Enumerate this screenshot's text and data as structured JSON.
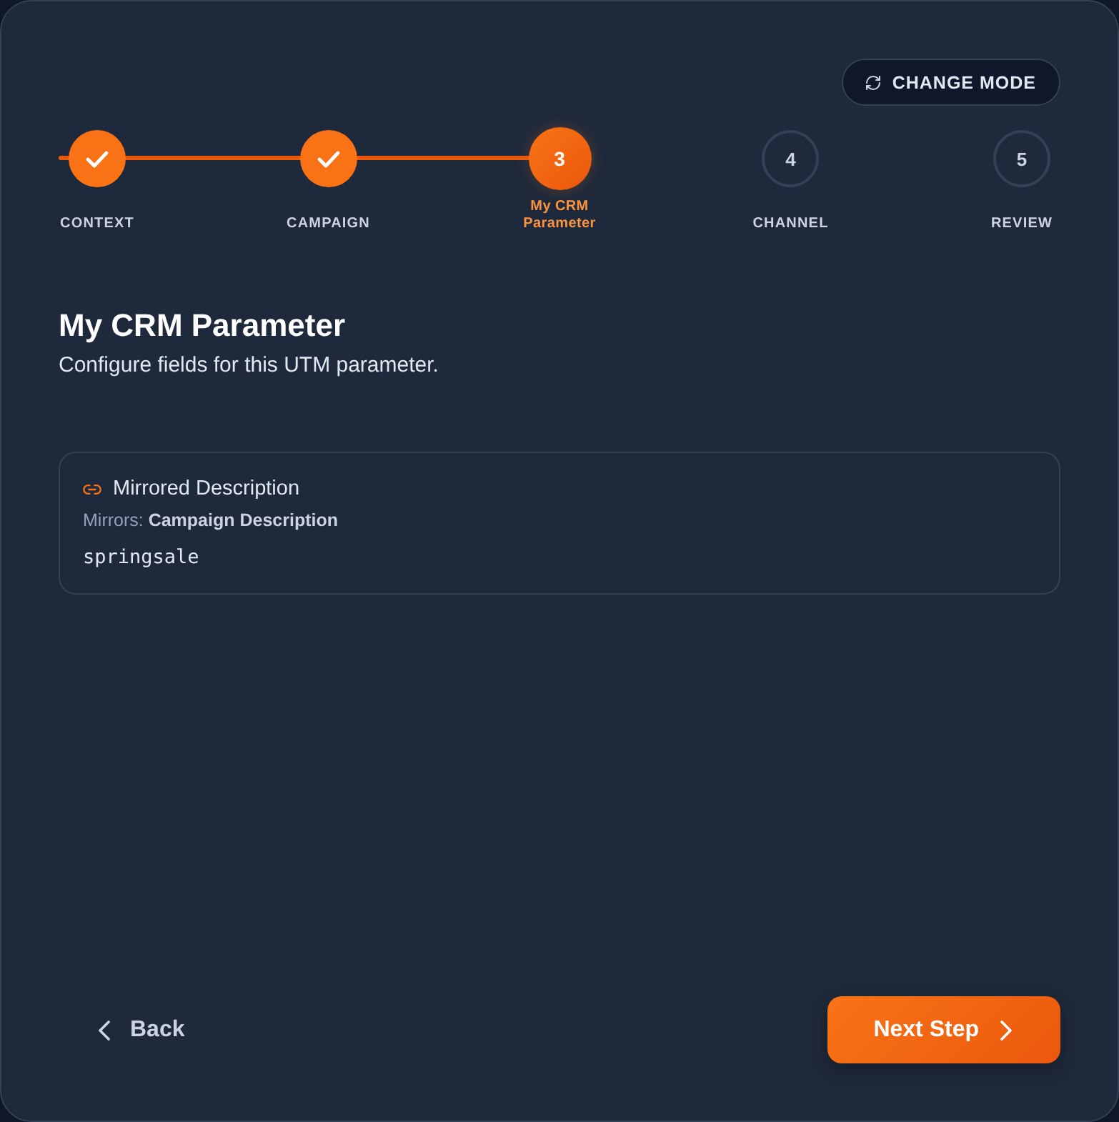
{
  "toolbar": {
    "change_mode_button": {
      "label": "CHANGE MODE"
    }
  },
  "stepper": {
    "steps": [
      {
        "label": "CONTEXT",
        "done": true,
        "selected": false
      },
      {
        "label": "CAMPAIGN",
        "done": true,
        "selected": false
      },
      {
        "number": "3",
        "label": "My CRM Parameter",
        "done": false,
        "selected": true
      },
      {
        "number": "4",
        "label": "CHANNEL",
        "done": false,
        "selected": false
      },
      {
        "number": "5",
        "label": "REVIEW",
        "done": false,
        "selected": false
      }
    ]
  },
  "page": {
    "title": "My CRM Parameter",
    "subtitle": "Configure fields for this UTM parameter."
  },
  "fields": [
    {
      "kind": "mirrored",
      "label": "Mirrored Description",
      "source": "Mirrors: **Campaign Description**",
      "value": "springsale"
    }
  ],
  "footer": {
    "back_button": {
      "label": "Back"
    },
    "next_button": {
      "label": "Next Step"
    }
  }
}
